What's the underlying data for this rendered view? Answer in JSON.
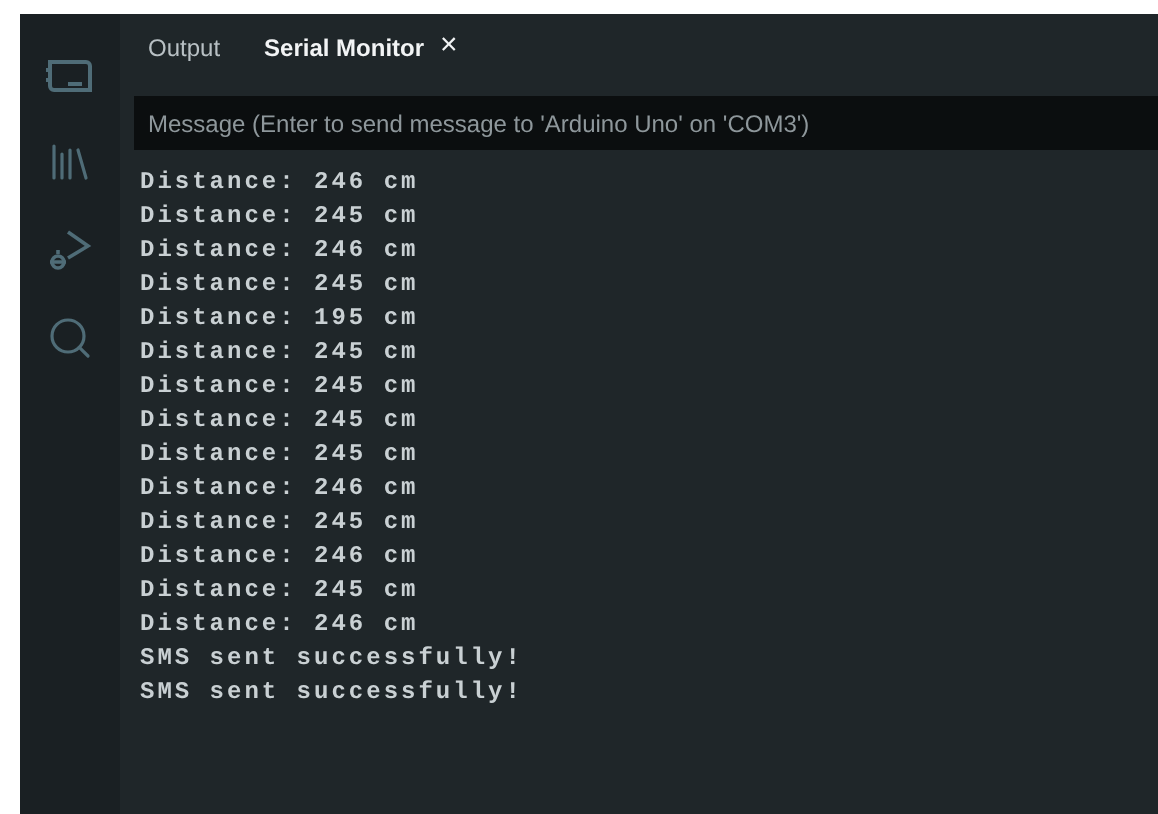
{
  "tabs": [
    {
      "label": "Output",
      "selected": false
    },
    {
      "label": "Serial Monitor",
      "selected": true,
      "close": "×"
    }
  ],
  "message_field": {
    "placeholder": "Message (Enter to send message to 'Arduino Uno' on 'COM3')"
  },
  "serial_output": [
    "Distance: 246 cm",
    "Distance: 245 cm",
    "Distance: 246 cm",
    "Distance: 245 cm",
    "Distance: 195 cm",
    "Distance: 245 cm",
    "Distance: 245 cm",
    "Distance: 245 cm",
    "Distance: 245 cm",
    "Distance: 246 cm",
    "Distance: 245 cm",
    "Distance: 246 cm",
    "Distance: 245 cm",
    "Distance: 246 cm",
    "SMS sent successfully!",
    "SMS sent successfully!"
  ]
}
